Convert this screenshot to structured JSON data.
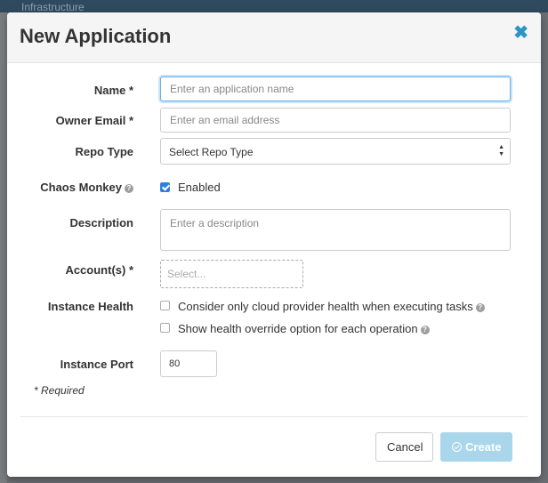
{
  "background": {
    "topbar_text": "Infrastructure"
  },
  "modal": {
    "title": "New Application",
    "close_icon": "close-icon"
  },
  "form": {
    "name": {
      "label": "Name *",
      "value": "",
      "placeholder": "Enter an application name"
    },
    "owner_email": {
      "label": "Owner Email *",
      "value": "",
      "placeholder": "Enter an email address"
    },
    "repo_type": {
      "label": "Repo Type",
      "selected": "Select Repo Type"
    },
    "chaos_monkey": {
      "label": "Chaos Monkey",
      "checkbox_label": "Enabled",
      "checked": true
    },
    "description": {
      "label": "Description",
      "value": "",
      "placeholder": "Enter a description"
    },
    "accounts": {
      "label": "Account(s) *",
      "placeholder": "Select..."
    },
    "instance_health": {
      "label": "Instance Health",
      "options": [
        {
          "label": "Consider only cloud provider health when executing tasks",
          "checked": false
        },
        {
          "label": "Show health override option for each operation",
          "checked": false
        }
      ]
    },
    "instance_port": {
      "label": "Instance Port",
      "value": "80"
    },
    "required_note": "* Required"
  },
  "footer": {
    "cancel_label": "Cancel",
    "create_label": "Create"
  },
  "colors": {
    "accent": "#2b95c6",
    "checkbox": "#2f7fe0",
    "create_disabled": "#a9d6ea"
  }
}
